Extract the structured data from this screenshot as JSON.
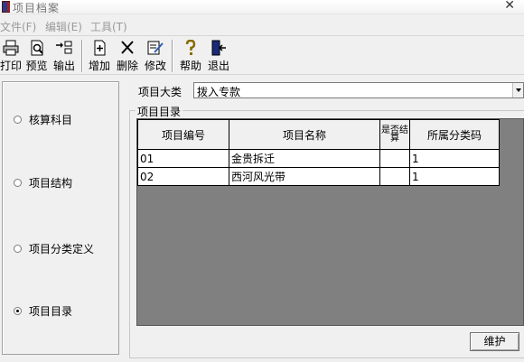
{
  "window": {
    "title": "项目档案"
  },
  "menu": [
    "文件(F)",
    "编辑(E)",
    "工具(T)"
  ],
  "toolbar": {
    "print": "打印",
    "preview": "预览",
    "export": "输出",
    "add": "增加",
    "delete": "删除",
    "edit": "修改",
    "help": "帮助",
    "exit": "退出"
  },
  "left_panel": {
    "options": [
      {
        "label": "核算科目",
        "selected": false
      },
      {
        "label": "项目结构",
        "selected": false
      },
      {
        "label": "项目分类定义",
        "selected": false
      },
      {
        "label": "项目目录",
        "selected": true
      }
    ]
  },
  "category": {
    "label": "项目大类",
    "value": "拨入专款"
  },
  "directory": {
    "legend": "项目目录",
    "columns": [
      "项目编号",
      "项目名称",
      "是否结算",
      "所属分类码"
    ],
    "rows": [
      {
        "code": "01",
        "name": "金贵拆迁",
        "settled": "",
        "class_code": "1"
      },
      {
        "code": "02",
        "name": "西河风光带",
        "settled": "",
        "class_code": "1"
      }
    ]
  },
  "maintain_button": "维护"
}
